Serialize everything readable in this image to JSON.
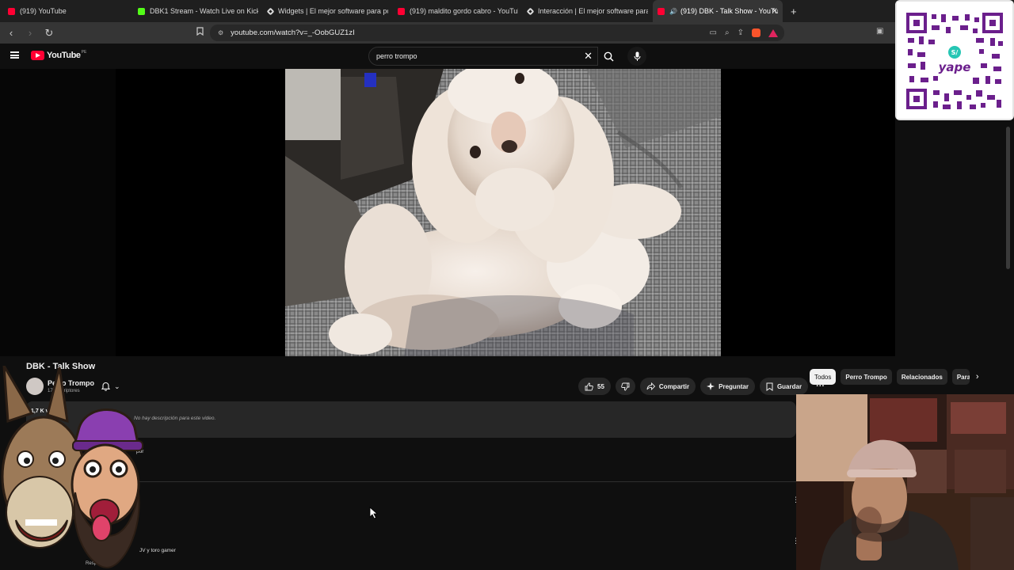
{
  "browser": {
    "tabs": [
      {
        "label": "(919) YouTube",
        "favicon": "youtube-favicon-icon",
        "active": false
      },
      {
        "label": "DBK1 Stream - Watch Live on Kick",
        "favicon": "kick-favicon-icon",
        "active": false
      },
      {
        "label": "Widgets | El mejor software para pot",
        "favicon": "widgets-favicon-icon",
        "active": false
      },
      {
        "label": "(919) maldito gordo cabro - YouTube",
        "favicon": "youtube-favicon-icon",
        "active": false
      },
      {
        "label": "Interacción | El mejor software para p",
        "favicon": "widgets-favicon-icon",
        "active": false
      },
      {
        "label": "(919) DBK - Talk Show - YouTu",
        "favicon": "youtube-favicon-icon",
        "active": true
      }
    ],
    "new_tab": "+",
    "url": "youtube.com/watch?v=_-OobGUZ1zI"
  },
  "youtube": {
    "logo_text": "YouTube",
    "country_code": "PE",
    "search_value": "perro trompo",
    "video": {
      "title": "DBK - Talk Show",
      "channel_name": "Perro Trompo",
      "channel_subs": "17 suscriptores",
      "likes": "55",
      "actions": {
        "share": "Compartir",
        "ask": "Preguntar",
        "save": "Guardar"
      }
    },
    "chips": [
      "Todos",
      "Perro Trompo",
      "Relacionados",
      "Para ti"
    ],
    "description": {
      "views": "1,7 K vistas",
      "text": "No hay descripción para este video."
    },
    "comments": {
      "c1": "por",
      "c2": "JV y toro gamer",
      "c3": "Responder"
    }
  },
  "overlays": {
    "qr_brand": "yape"
  },
  "colors": {
    "youtube_red": "#ff0033",
    "background": "#0f0f0f",
    "pill": "#272727"
  }
}
